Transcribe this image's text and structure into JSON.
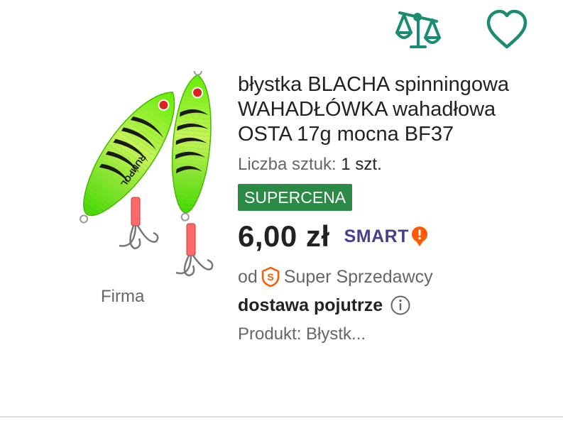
{
  "actions": {
    "compare_icon": "scale-compare-icon",
    "favorite_icon": "heart-icon",
    "accent_color": "#1a8c72"
  },
  "image": {
    "brand_label": "Firma",
    "lure_logo_text": "RUMPOL"
  },
  "product": {
    "title": "błystka BLACHA spinningowa WAHADŁÓWKA wahadłowa OSTA 17g mocna BF37",
    "quantity_label": "Liczba sztuk:",
    "quantity_value": "1 szt.",
    "badge": "SUPERCENA",
    "badge_color": "#2a8a46",
    "price": "6,00 zł",
    "smart_label": "SMART",
    "smart_color": "#4a3d8a",
    "smart_icon_color": "#ff5a00",
    "seller_prefix": "od",
    "seller_label": "Super Sprzedawcy",
    "seller_badge_color": "#ff5a00",
    "delivery": "dostawa pojutrze",
    "meta": "Produkt: Błystk..."
  }
}
